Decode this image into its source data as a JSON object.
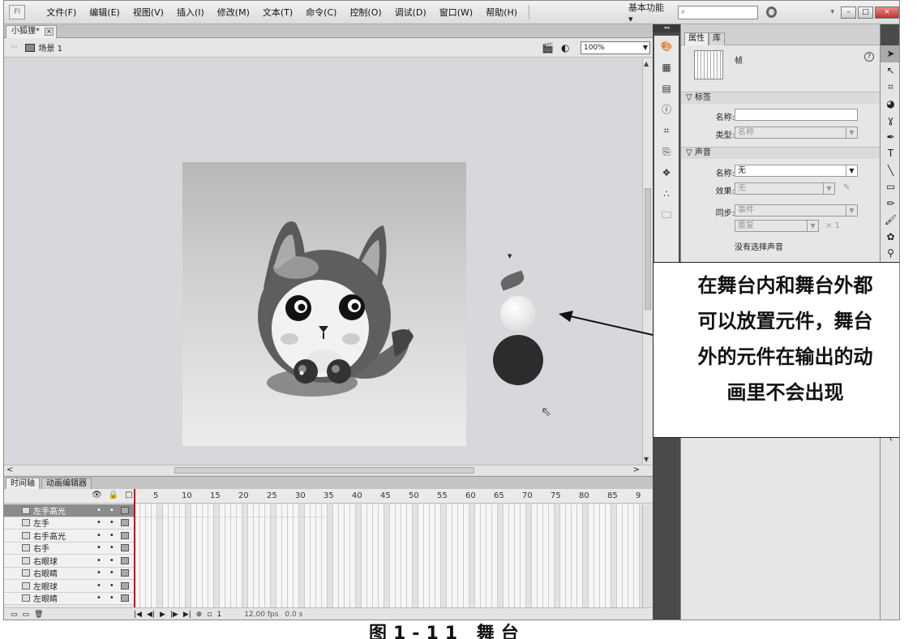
{
  "menubar": {
    "items": [
      "文件(F)",
      "编辑(E)",
      "视图(V)",
      "插入(I)",
      "修改(M)",
      "文本(T)",
      "命令(C)",
      "控制(O)",
      "调试(D)",
      "窗口(W)",
      "帮助(H)"
    ],
    "workspace": "基本功能 ▾",
    "search_placeholder": "",
    "min": "–",
    "max": "□",
    "close": "×"
  },
  "document": {
    "tab": "小狐狸*",
    "scene": "场景 1",
    "zoom": "100%"
  },
  "callout": {
    "lines": [
      "在舞台内和舞台外都",
      "可以放置元件，舞台",
      "外的元件在输出的动",
      "画里不会出现"
    ]
  },
  "timeline": {
    "tabs": [
      "时间轴",
      "动画编辑器"
    ],
    "ruler": [
      "5",
      "10",
      "15",
      "20",
      "25",
      "30",
      "35",
      "40",
      "45",
      "50",
      "55",
      "60",
      "65",
      "70",
      "75",
      "80",
      "85",
      "9"
    ],
    "layers": [
      "左手高光",
      "左手",
      "右手高光",
      "右手",
      "右眼球",
      "右眼睛",
      "左眼球",
      "左眼睛"
    ],
    "selected_layer": 0,
    "fps": "12.00 fps",
    "time": "0.0 s",
    "frame": "1"
  },
  "properties": {
    "tabs": [
      "属性",
      "库"
    ],
    "type": "帧",
    "section_label": "▽ 标签",
    "name_label": "名称:",
    "name_value": "",
    "kind_label": "类型:",
    "kind_value": "名称",
    "section_sound": "▽ 声音",
    "sound_name_label": "名称:",
    "sound_name_value": "无",
    "effect_label": "效果:",
    "effect_value": "无",
    "sync_label": "同步:",
    "sync_value": "事件",
    "repeat_value": "重复",
    "repeat_count": "× 1",
    "no_sound": "没有选择声音"
  },
  "caption": "图1-11 舞台"
}
